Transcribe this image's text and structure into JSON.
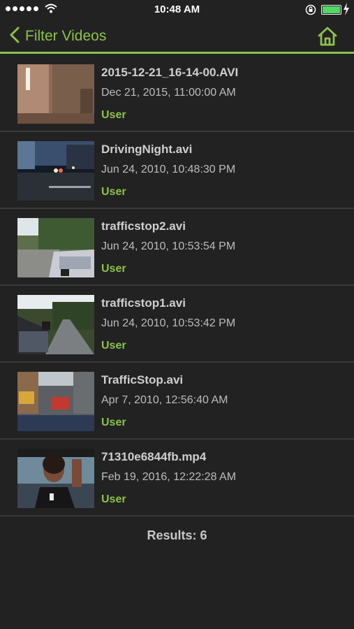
{
  "status_bar": {
    "time": "10:48 AM",
    "signal_icon": "signal-dots-icon",
    "wifi_icon": "wifi-icon",
    "battery_color": "#4cd964"
  },
  "nav": {
    "back_label": "Filter Videos",
    "back_icon": "chevron-left-icon",
    "home_icon": "home-icon",
    "accent": "#8bc34a"
  },
  "videos": [
    {
      "name": "2015-12-21_16-14-00.AVI",
      "date": "Dec 21, 2015, 11:00:00 AM",
      "source": "User"
    },
    {
      "name": "DrivingNight.avi",
      "date": "Jun 24, 2010, 10:48:30 PM",
      "source": "User"
    },
    {
      "name": "trafficstop2.avi",
      "date": "Jun 24, 2010, 10:53:54 PM",
      "source": "User"
    },
    {
      "name": "trafficstop1.avi",
      "date": "Jun 24, 2010, 10:53:42 PM",
      "source": "User"
    },
    {
      "name": "TrafficStop.avi",
      "date": "Apr 7, 2010, 12:56:40 AM",
      "source": "User"
    },
    {
      "name": "71310e6844fb.mp4",
      "date": "Feb 19, 2016, 12:22:28 AM",
      "source": "User"
    }
  ],
  "results_label": "Results: 6"
}
